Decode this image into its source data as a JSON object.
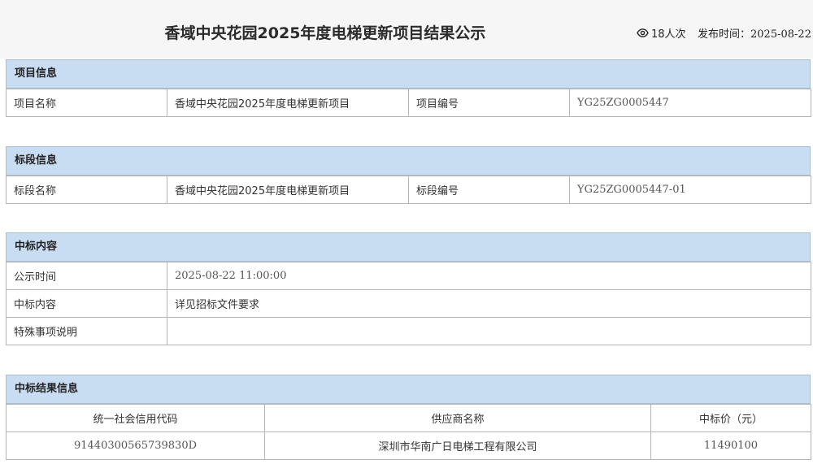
{
  "header": {
    "title": "香域中央花园2025年度电梯更新项目结果公示",
    "views": "18人次",
    "publish_label": "发布时间：",
    "publish_date": "2025-08-22"
  },
  "project_info": {
    "heading": "项目信息",
    "name_label": "项目名称",
    "name_value": "香域中央花园2025年度电梯更新项目",
    "code_label": "项目编号",
    "code_value": "YG25ZG0005447"
  },
  "section_info": {
    "heading": "标段信息",
    "name_label": "标段名称",
    "name_value": "香域中央花园2025年度电梯更新项目",
    "code_label": "标段编号",
    "code_value": "YG25ZG0005447-01"
  },
  "award_content": {
    "heading": "中标内容",
    "rows": [
      {
        "label": "公示时间",
        "value": "2025-08-22 11:00:00"
      },
      {
        "label": "中标内容",
        "value": "详见招标文件要求"
      },
      {
        "label": "特殊事项说明",
        "value": ""
      }
    ]
  },
  "award_result": {
    "heading": "中标结果信息",
    "columns": [
      "统一社会信用代码",
      "供应商名称",
      "中标价（元）"
    ],
    "rows": [
      [
        "91440300565739830D",
        "深圳市华南广日电梯工程有限公司",
        "11490100"
      ]
    ]
  },
  "icons": {
    "views": "eye-icon"
  }
}
